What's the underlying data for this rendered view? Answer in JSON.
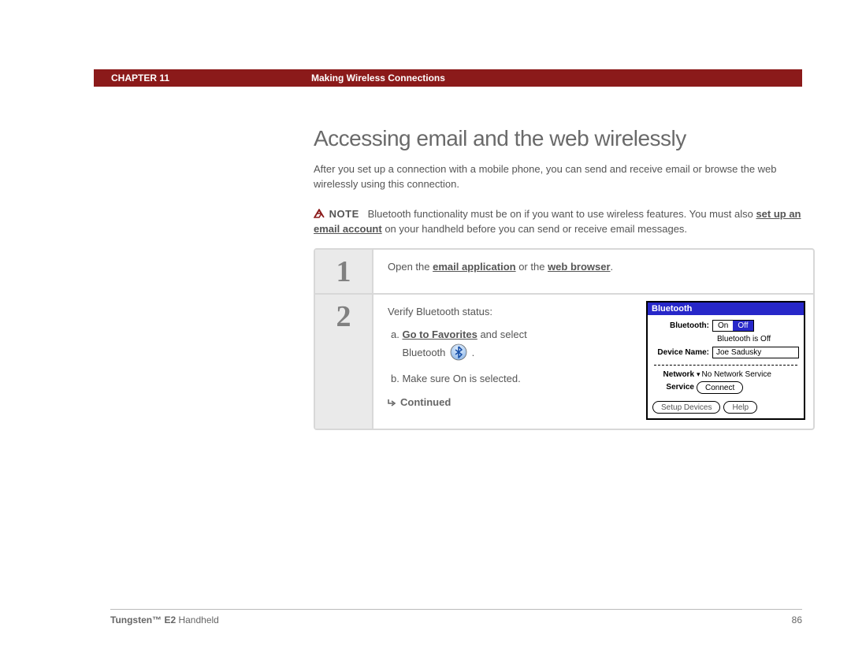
{
  "header": {
    "chapter_label": "CHAPTER 11",
    "chapter_title": "Making Wireless Connections"
  },
  "page": {
    "heading": "Accessing email and the web wirelessly",
    "intro": "After you set up a connection with a mobile phone, you can send and receive email or browse the web wirelessly using this connection.",
    "note_label": "NOTE",
    "note_text_before": "Bluetooth functionality must be on if you want to use wireless features. You must also ",
    "note_link": "set up an email account",
    "note_text_after": " on your handheld before you can send or receive email messages."
  },
  "steps": {
    "s1": {
      "num": "1",
      "text_before": "Open the ",
      "link1": "email application",
      "mid": " or the ",
      "link2": "web browser",
      "after": "."
    },
    "s2": {
      "num": "2",
      "verify": "Verify Bluetooth status:",
      "a_prefix": "a.  ",
      "a_link": "Go to Favorites",
      "a_mid": " and select",
      "a_indent": "Bluetooth ",
      "a_end": " .",
      "b": "b.  Make sure On is selected.",
      "continued": "Continued"
    }
  },
  "bt_panel": {
    "title": "Bluetooth",
    "bluetooth_label": "Bluetooth:",
    "on": "On",
    "off": "Off",
    "status": "Bluetooth is Off",
    "device_name_label": "Device Name:",
    "device_name": "Joe Sadusky",
    "network_label": "Network",
    "network_value": "No Network Service",
    "service_label": "Service",
    "connect": "Connect",
    "setup_devices": "Setup Devices",
    "help": "Help"
  },
  "footer": {
    "product_bold": "Tungsten™ E2",
    "product_rest": " Handheld",
    "page_number": "86"
  }
}
